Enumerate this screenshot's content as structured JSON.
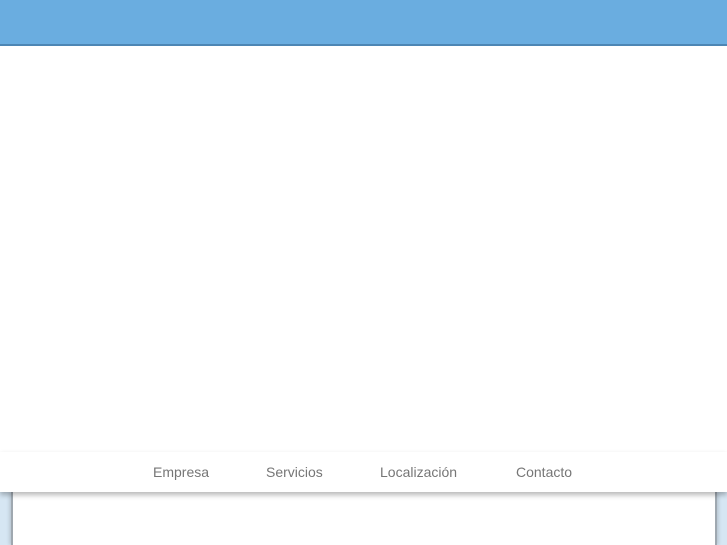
{
  "colors": {
    "header_bar": "#6aade0",
    "header_border": "#4d86b4",
    "nav_text": "#767676",
    "frame_background": "#d6e6f3",
    "panel_border": "#9fa8b0"
  },
  "nav": {
    "items": [
      {
        "label": "Empresa"
      },
      {
        "label": "Servicios"
      },
      {
        "label": "Localización"
      },
      {
        "label": "Contacto"
      }
    ]
  }
}
